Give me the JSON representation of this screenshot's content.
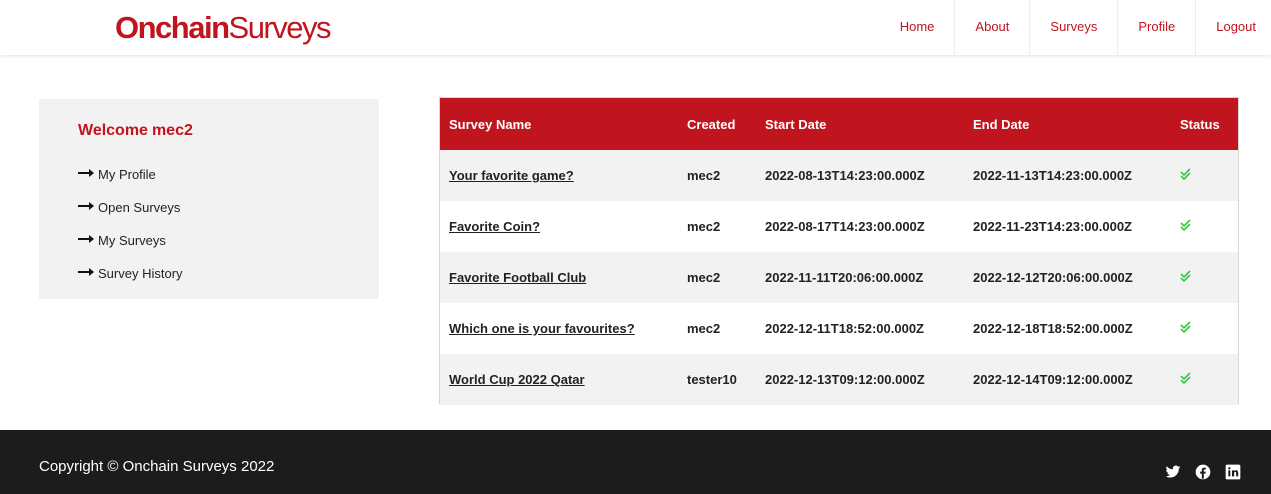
{
  "brand": {
    "bold": "Onchain",
    "light": "Surveys"
  },
  "nav": [
    "Home",
    "About",
    "Surveys",
    "Profile",
    "Logout"
  ],
  "sidebar": {
    "welcome_prefix": "Welcome",
    "username": "mec2",
    "items": [
      "My Profile",
      "Open Surveys",
      "My Surveys",
      "Survey History"
    ]
  },
  "table": {
    "headers": [
      "Survey Name",
      "Created",
      "Start Date",
      "End Date",
      "Status"
    ],
    "rows": [
      {
        "name": "Your favorite game?",
        "created": "mec2",
        "start": "2022-08-13T14:23:00.000Z",
        "end": "2022-11-13T14:23:00.000Z",
        "status": "check-icon"
      },
      {
        "name": "Favorite Coin?",
        "created": "mec2",
        "start": "2022-08-17T14:23:00.000Z",
        "end": "2022-11-23T14:23:00.000Z",
        "status": "check-icon"
      },
      {
        "name": "Favorite Football Club",
        "created": "mec2",
        "start": "2022-11-11T20:06:00.000Z",
        "end": "2022-12-12T20:06:00.000Z",
        "status": "check-icon"
      },
      {
        "name": "Which one is your favourites?",
        "created": "mec2",
        "start": "2022-12-11T18:52:00.000Z",
        "end": "2022-12-18T18:52:00.000Z",
        "status": "check-icon"
      },
      {
        "name": "World Cup 2022 Qatar",
        "created": "tester10",
        "start": "2022-12-13T09:12:00.000Z",
        "end": "2022-12-14T09:12:00.000Z",
        "status": "check-icon"
      }
    ]
  },
  "footer": {
    "copyright": "Copyright © Onchain Surveys 2022",
    "social": [
      "twitter-icon",
      "facebook-icon",
      "linkedin-icon"
    ]
  },
  "colors": {
    "brand": "#c0151f",
    "status_ok": "#2ecc40",
    "footer_bg": "#1c1c1c"
  }
}
